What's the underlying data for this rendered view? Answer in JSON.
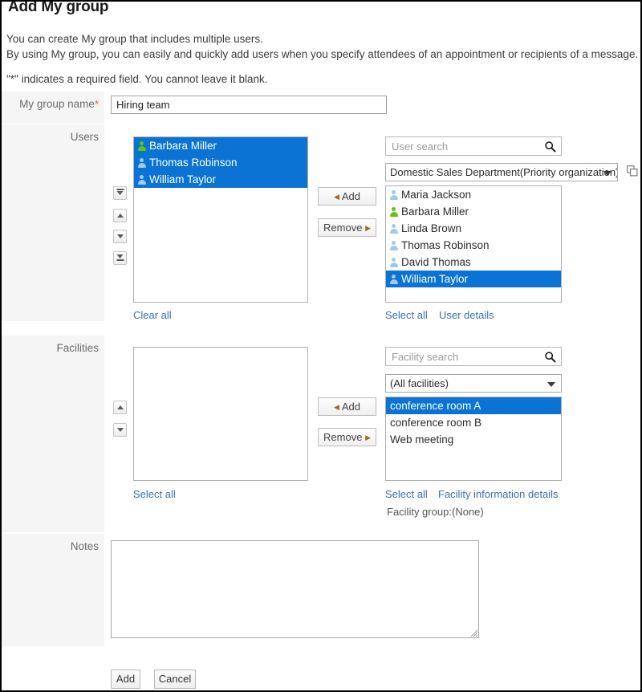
{
  "page": {
    "title": "Add My group",
    "description_line1": "You can create My group that includes multiple users.",
    "description_line2": "By using My group, you can easily and quickly add users when you specify attendees of an appointment or recipients of a message.",
    "required_note": "\"*\" indicates a required field. You cannot leave it blank."
  },
  "colors": {
    "selection_blue": "#0a73d4",
    "link_blue": "#3b6fb5",
    "label_bg": "#f5f5f5",
    "required_asterisk": "#e8573f",
    "user_icon_default": "#9ecbe8",
    "user_icon_active": "#63c40f"
  },
  "group_name": {
    "label": "My group name",
    "required_marker": "*",
    "value": "Hiring team",
    "placeholder": ""
  },
  "users": {
    "label": "Users",
    "selected_list": [
      {
        "name": "Barbara Miller",
        "icon": "user-icon",
        "icon_state": "active",
        "selected": true
      },
      {
        "name": "Thomas Robinson",
        "icon": "user-icon",
        "icon_state": "default",
        "selected": true
      },
      {
        "name": "William Taylor",
        "icon": "user-icon",
        "icon_state": "default",
        "selected": true
      }
    ],
    "clear_all_label": "Clear all",
    "order_buttons": [
      {
        "name": "move-to-top-button",
        "icon": "arrow-to-top-icon"
      },
      {
        "name": "move-up-button",
        "icon": "arrow-up-icon"
      },
      {
        "name": "move-down-button",
        "icon": "arrow-down-icon"
      },
      {
        "name": "move-to-bottom-button",
        "icon": "arrow-to-bottom-icon"
      }
    ],
    "add_label": "Add",
    "remove_label": "Remove",
    "search_placeholder": "User search",
    "search_value": "",
    "search_icon": "magnifier-icon",
    "org_selected": "Domestic Sales Department(Priority organization)",
    "org_options": [
      "Domestic Sales Department(Priority organization)"
    ],
    "duplicate_icon": "duplicate-window-icon",
    "candidate_list": [
      {
        "name": "Maria Jackson",
        "icon": "user-icon",
        "icon_state": "default",
        "selected": false
      },
      {
        "name": "Barbara Miller",
        "icon": "user-icon",
        "icon_state": "active",
        "selected": false
      },
      {
        "name": "Linda Brown",
        "icon": "user-icon",
        "icon_state": "default",
        "selected": false
      },
      {
        "name": "Thomas Robinson",
        "icon": "user-icon",
        "icon_state": "default",
        "selected": false
      },
      {
        "name": "David Thomas",
        "icon": "user-icon",
        "icon_state": "default",
        "selected": false
      },
      {
        "name": "William Taylor",
        "icon": "user-icon",
        "icon_state": "default",
        "selected": true
      }
    ],
    "select_all_label": "Select all",
    "user_details_label": "User details"
  },
  "facilities": {
    "label": "Facilities",
    "selected_list": [],
    "select_all_left_label": "Select all",
    "order_buttons": [
      {
        "name": "move-up-button",
        "icon": "arrow-up-icon"
      },
      {
        "name": "move-down-button",
        "icon": "arrow-down-icon"
      }
    ],
    "add_label": "Add",
    "remove_label": "Remove",
    "search_placeholder": "Facility search",
    "search_value": "",
    "search_icon": "magnifier-icon",
    "group_selected": "(All facilities)",
    "group_options": [
      "(All facilities)"
    ],
    "candidate_list": [
      {
        "name": "conference room A",
        "selected": true
      },
      {
        "name": "conference room B",
        "selected": false
      },
      {
        "name": "Web meeting",
        "selected": false
      }
    ],
    "select_all_label": "Select all",
    "details_label": "Facility information details",
    "facility_group_caption": "Facility group:",
    "facility_group_value": "(None)"
  },
  "notes": {
    "label": "Notes",
    "value": "",
    "placeholder": ""
  },
  "footer": {
    "submit_label": "Add",
    "cancel_label": "Cancel"
  }
}
